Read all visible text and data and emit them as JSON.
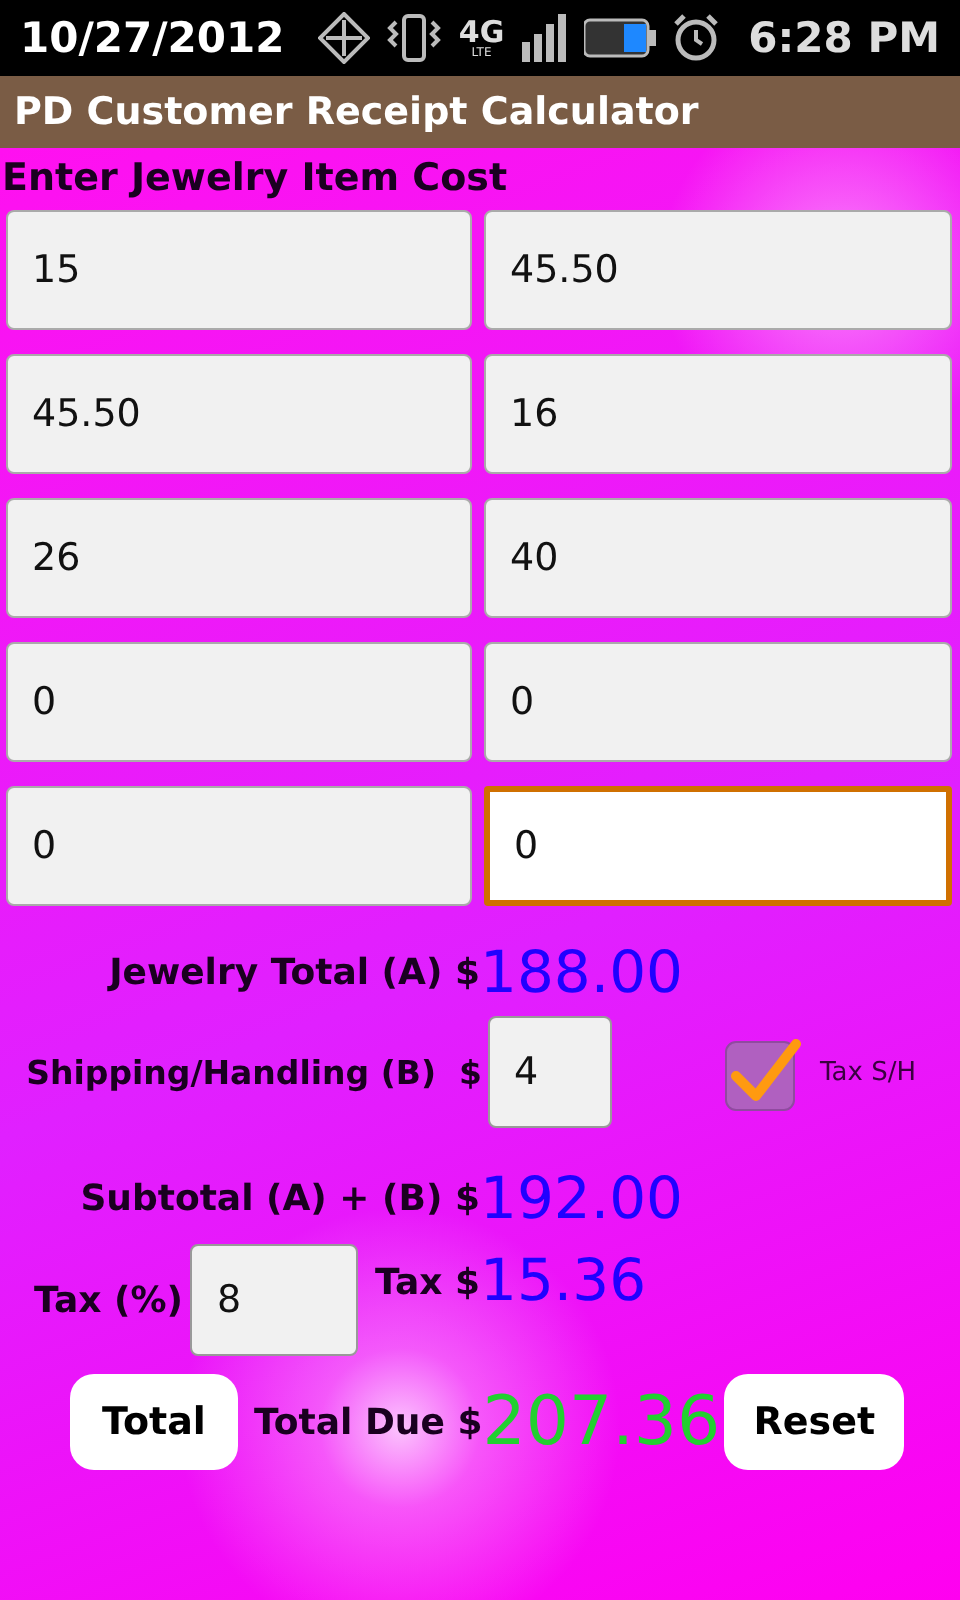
{
  "status_bar": {
    "date": "10/27/2012",
    "network": "4G",
    "network_sub": "LTE",
    "time": "6:28 PM"
  },
  "title_bar": {
    "title": "PD Customer Receipt Calculator"
  },
  "items_label": "Enter Jewelry Item Cost",
  "item_fields": [
    {
      "value": "15",
      "focused": false
    },
    {
      "value": "45.50",
      "focused": false
    },
    {
      "value": "45.50",
      "focused": false
    },
    {
      "value": "16",
      "focused": false
    },
    {
      "value": "26",
      "focused": false
    },
    {
      "value": "40",
      "focused": false
    },
    {
      "value": "0",
      "focused": false
    },
    {
      "value": "0",
      "focused": false
    },
    {
      "value": "0",
      "focused": false
    },
    {
      "value": "0",
      "focused": true
    }
  ],
  "jewelry_total": {
    "label": "Jewelry Total (A)",
    "currency": "$",
    "value": "188.00"
  },
  "shipping": {
    "label": "Shipping/Handling (B)",
    "currency": "$",
    "value": "4"
  },
  "tax_sh": {
    "label": "Tax S/H",
    "checked": true
  },
  "subtotal": {
    "label": "Subtotal (A) + (B)",
    "currency": "$",
    "value": "192.00"
  },
  "tax_percent": {
    "label": "Tax (%)",
    "value": "8"
  },
  "tax_amount": {
    "label": "Tax",
    "currency": "$",
    "value": "15.36"
  },
  "buttons": {
    "total": "Total",
    "reset": "Reset"
  },
  "total_due": {
    "label": "Total Due",
    "currency": "$",
    "value": "207.36"
  }
}
